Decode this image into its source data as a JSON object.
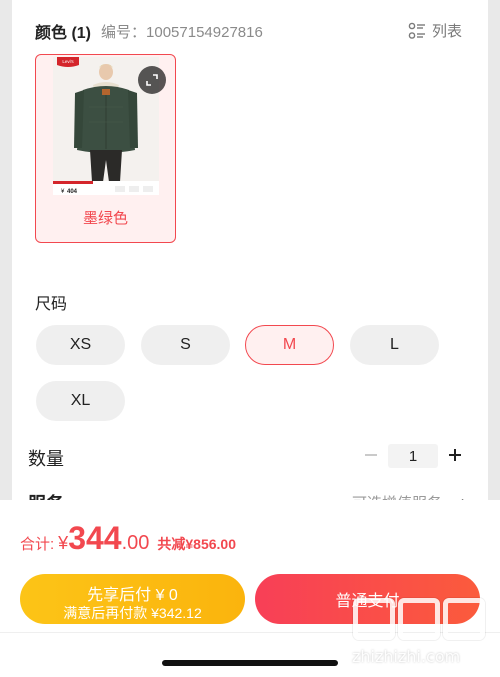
{
  "color_section": {
    "title": "颜色 (1)",
    "sku": "编号：10057154927816",
    "list_label": "列表",
    "selected_swatch": {
      "label": "墨绿色",
      "brand_tag": "Levi's",
      "price_tag": "404"
    }
  },
  "size_section": {
    "title": "尺码",
    "sizes": [
      "XS",
      "S",
      "M",
      "L",
      "XL"
    ],
    "selected": "M"
  },
  "quantity": {
    "label": "数量",
    "value": "1"
  },
  "service": {
    "label": "服务",
    "value": "可选增值服务"
  },
  "summary": {
    "total_label": "合计:",
    "currency": "¥",
    "amount_int": "344",
    "amount_dec": ".00",
    "discount": "共减¥856.00"
  },
  "buttons": {
    "credit_line1": "先享后付 ¥ 0",
    "credit_line2": "满意后再付款 ¥342.12",
    "pay": "普通支付"
  },
  "watermark": {
    "text": "zhizhizhi.com"
  },
  "colors": {
    "accent": "#f2484f",
    "credit_button": "#fbb40d",
    "pay_button": "#f94b4b"
  }
}
